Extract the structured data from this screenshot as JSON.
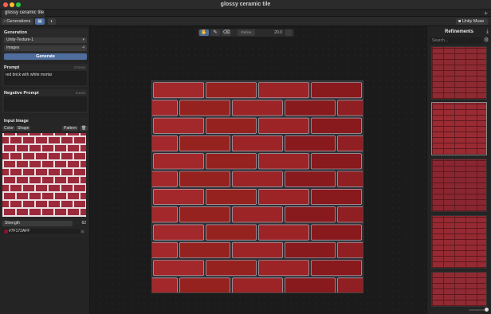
{
  "window": {
    "title": "glossy ceramic tile"
  },
  "tabs": [
    {
      "label": "glossy ceramic tile"
    }
  ],
  "toolbar": {
    "back_label": "Generations",
    "model_label": "Unity Muse"
  },
  "generation": {
    "title": "Generation",
    "model": "Unity-Texture-1",
    "images_label": "Images",
    "images_value": "4",
    "generate_label": "Generate"
  },
  "prompt": {
    "title": "Prompt",
    "counter": "27/2024",
    "text": "red brick with white mortar"
  },
  "negative": {
    "title": "Negative Prompt",
    "counter": "0/1024",
    "text": ""
  },
  "input_image": {
    "title": "Input Image",
    "color_label": "Color",
    "shape_label": "Shape",
    "pattern_label": "Pattern",
    "strength_label": "Strength",
    "strength_value": "62",
    "color_hex": "#7F172AFF",
    "swatch_color": "#7f172a"
  },
  "canvas": {
    "field_placeholder": "Refine",
    "zoom_value": "20.0"
  },
  "refinements": {
    "title": "Refinements",
    "search_placeholder": "Search...",
    "count": 5
  }
}
